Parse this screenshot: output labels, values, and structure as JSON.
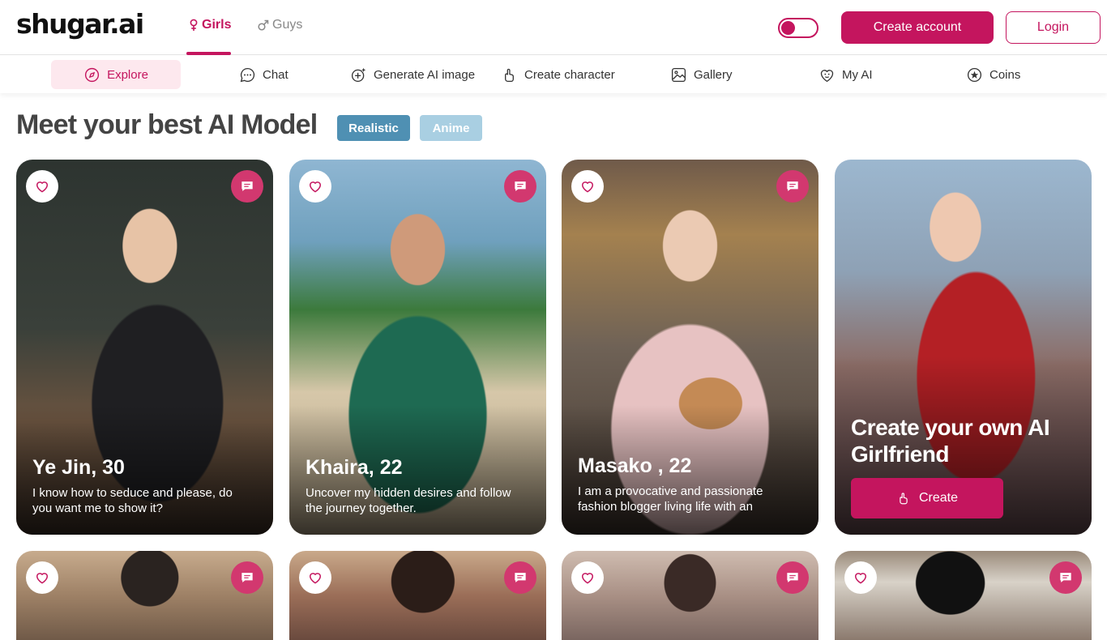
{
  "header": {
    "logo": "shugar.ai",
    "gender_tabs": [
      {
        "label": "Girls",
        "icon": "female-symbol-icon",
        "active": true
      },
      {
        "label": "Guys",
        "icon": "male-symbol-icon",
        "active": false
      }
    ],
    "create_account_label": "Create account",
    "login_label": "Login"
  },
  "nav": {
    "items": [
      {
        "label": "Explore",
        "icon": "compass-icon",
        "active": true
      },
      {
        "label": "Chat",
        "icon": "chat-bubble-icon"
      },
      {
        "label": "Generate AI image",
        "icon": "sparkle-plus-icon"
      },
      {
        "label": "Create character",
        "icon": "finger-icon"
      },
      {
        "label": "Gallery",
        "icon": "image-icon"
      },
      {
        "label": "My AI",
        "icon": "heart-face-icon"
      },
      {
        "label": "Coins",
        "icon": "coin-icon"
      }
    ]
  },
  "main": {
    "title": "Meet your best AI Model",
    "styles": {
      "realistic": "Realistic",
      "anime": "Anime"
    }
  },
  "cards": [
    {
      "name": "Ye Jin, 30",
      "desc": "I know how to seduce and please, do you want me to show it?"
    },
    {
      "name": "Khaira, 22",
      "desc": "Uncover my hidden desires and follow the journey together."
    },
    {
      "name": "Masako , 22",
      "desc": "I am a provocative and passionate fashion blogger living life with an"
    }
  ],
  "cta_card": {
    "title": "Create your own AI Girlfriend",
    "button_label": "Create"
  },
  "colors": {
    "brand": "#c4155e",
    "realistic": "#4f90b3",
    "anime": "#a9cfe2"
  }
}
